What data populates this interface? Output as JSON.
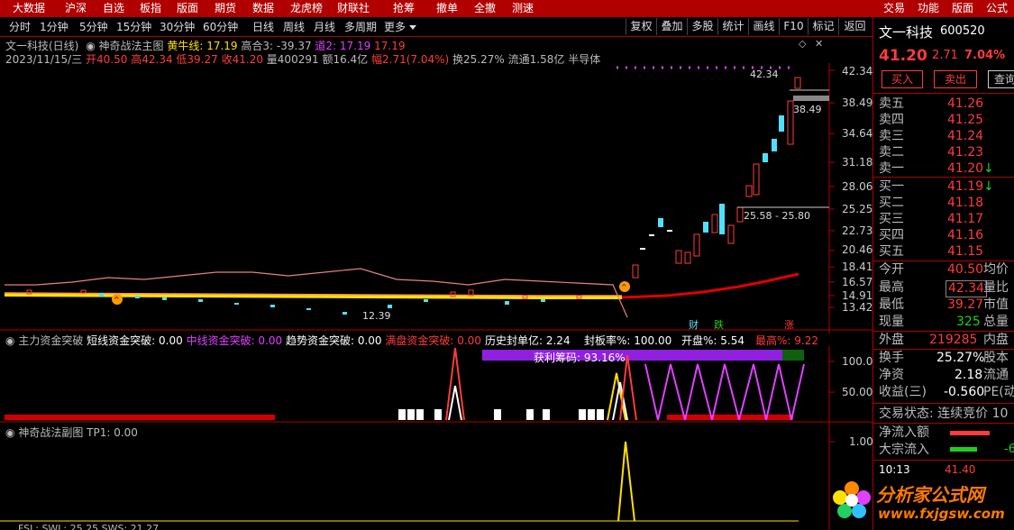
{
  "menu": [
    "大数据",
    "沪深",
    "自选",
    "板指",
    "版面",
    "期货",
    "数据",
    "龙虎榜",
    "财联社",
    "抢筹",
    "撤单",
    "全撤",
    "测速"
  ],
  "menu_right": [
    "交易",
    "功能",
    "版面",
    "公式"
  ],
  "period_tabs": [
    "分时",
    "1分钟",
    "5分钟",
    "15分钟",
    "30分钟",
    "60分钟",
    "日线",
    "周线",
    "月线",
    "多周期",
    "更多"
  ],
  "toolbar": [
    "复权",
    "叠加",
    "多股",
    "统计",
    "画线",
    "F10",
    "标记",
    "返回"
  ],
  "header": {
    "stock_name": "文一科技(日线)",
    "indicator": "神奇战法主图",
    "yellow_bull": "黄牛线: 17.19",
    "gao_he": "高合3: -39.37",
    "dao": "道2: 17.19",
    "dao2": "17.19",
    "date": "2023/11/15/三",
    "open": "开40.50",
    "high": "高42.34",
    "low": "低39.27",
    "close": "收41.20",
    "vol": "量400291",
    "amount": "额16.4亿",
    "pct": "幅2.71(7.04%)",
    "turnover": "换25.27%",
    "float": "流通1.58亿",
    "sector": "半导体"
  },
  "price_axis": [
    "42.34",
    "38.49",
    "34.64",
    "31.18",
    "28.06",
    "25.25",
    "22.73",
    "20.46",
    "18.41",
    "16.57",
    "14.91",
    "13.42"
  ],
  "annotations": {
    "high_label": "42.34",
    "mid_label": "38.49",
    "range_label": "25.58 - 25.80",
    "low_label": "12.39",
    "cai": "财",
    "die": "跌",
    "zhang": "涨"
  },
  "sub1": {
    "title": "主力资金突破",
    "short": "短线资金突破: 0.00",
    "mid": "中线资金突破: 0.00",
    "trend": "趋势资金突破: 0.00",
    "full": "满盘资金突破: 0.00",
    "hist": "历史封单亿: 2.24",
    "seal": "封板率%: 100.00",
    "open_pct": "开盘%: 5.54",
    "max_pct": "最高%: 9.22",
    "profit": "获利筹码: 93.16%",
    "axis": [
      "100.0",
      "50.00"
    ]
  },
  "sub2": {
    "title": "神奇战法副图",
    "tp": "TP1: 0.00",
    "axis": [
      "1.00"
    ],
    "bottom": "FSL: SWL: 25.25 SWS: 21.27"
  },
  "quote": {
    "name": "文一科技",
    "code": "600520",
    "price": "41.20",
    "change": "2.71",
    "pct": "7.04%",
    "buttons": [
      "买入",
      "卖出",
      "查询"
    ],
    "asks": [
      {
        "label": "卖五",
        "price": "41.26"
      },
      {
        "label": "卖四",
        "price": "41.25"
      },
      {
        "label": "卖三",
        "price": "41.24"
      },
      {
        "label": "卖二",
        "price": "41.23"
      },
      {
        "label": "卖一",
        "price": "41.20"
      }
    ],
    "bids": [
      {
        "label": "买一",
        "price": "41.19"
      },
      {
        "label": "买二",
        "price": "41.18"
      },
      {
        "label": "买三",
        "price": "41.17"
      },
      {
        "label": "买四",
        "price": "41.16"
      },
      {
        "label": "买五",
        "price": "41.15"
      }
    ],
    "stats": [
      {
        "l": "今开",
        "v": "40.50",
        "l2": "均价"
      },
      {
        "l": "最高",
        "v": "42.34",
        "l2": "量比"
      },
      {
        "l": "最低",
        "v": "39.27",
        "l2": "市值"
      },
      {
        "l": "现量",
        "v": "325",
        "l2": "总量"
      },
      {
        "l": "外盘",
        "v": "219285",
        "l2": "内盘"
      },
      {
        "l": "换手",
        "v": "25.27%",
        "l2": "股本"
      },
      {
        "l": "净资",
        "v": "2.18",
        "l2": "流通"
      },
      {
        "l": "收益(三)",
        "v": "-0.560",
        "l2": "PE(动)"
      }
    ],
    "trade_state": "交易状态: 连续竞价 10",
    "net_inflow": "净流入额",
    "big_inflow": "大宗流入",
    "big_inflow_val": "-6",
    "time": "10:13",
    "last": "41.40"
  },
  "watermark": {
    "name": "分析家公式网",
    "url": "www.fxjgsw.com"
  }
}
